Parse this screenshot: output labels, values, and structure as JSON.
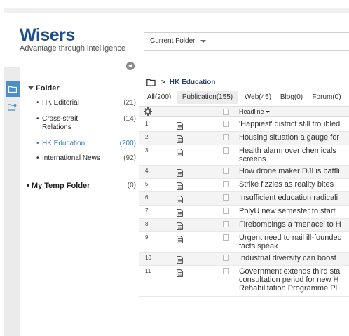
{
  "brand": {
    "name": "Wisers",
    "tagline": "Advantage through intelligence"
  },
  "search": {
    "scope": "Current Folder"
  },
  "sidebar": {
    "folder_label": "Folder",
    "items": [
      {
        "label": "HK Editorial",
        "count": "(21)"
      },
      {
        "label": "Cross-strait Relations",
        "count": "(14)"
      },
      {
        "label": "HK Education",
        "count": "(200)"
      },
      {
        "label": "International News",
        "count": "(92)"
      }
    ],
    "temp_folder": {
      "label": "My Temp Folder",
      "count": "(0)"
    }
  },
  "breadcrumb": {
    "separator": ">",
    "current": "HK Education"
  },
  "tabs": [
    {
      "label": "All(200)"
    },
    {
      "label": "Publication(155)"
    },
    {
      "label": "Web(45)"
    },
    {
      "label": "Blog(0)"
    },
    {
      "label": "Forum(0)"
    }
  ],
  "table": {
    "header": "Headline",
    "rows": [
      {
        "num": "1",
        "headline": "'Happiest' district still troubled"
      },
      {
        "num": "2",
        "headline": "Housing situation a gauge for"
      },
      {
        "num": "3",
        "headline": "Health alarm over chemicals screens"
      },
      {
        "num": "4",
        "headline": "How drone maker DJI is battli"
      },
      {
        "num": "5",
        "headline": "Strike fizzles as reality bites"
      },
      {
        "num": "6",
        "headline": "Insufficient education radicali"
      },
      {
        "num": "7",
        "headline": "PolyU new semester to start"
      },
      {
        "num": "8",
        "headline": "Firebombings a ‘menace’ to H"
      },
      {
        "num": "9",
        "headline": "Urgent need to nail ill-founded facts speak"
      },
      {
        "num": "10",
        "headline": "Industrial diversity can boost"
      },
      {
        "num": "11",
        "headline": "Government extends third sta consultation period for new H Rehabilitation Programme Pl"
      }
    ]
  },
  "colors": {
    "brand": "#1f4e8c",
    "accent": "#4a90c8",
    "active_link": "#2f7fc1"
  }
}
